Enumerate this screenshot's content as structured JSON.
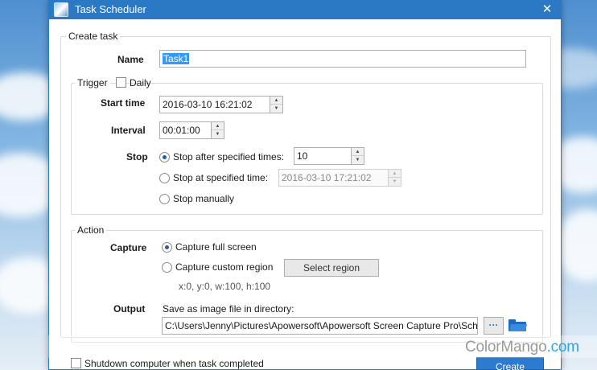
{
  "window": {
    "title": "Task Scheduler",
    "close_glyph": "✕",
    "accent_color": "#2b78c5"
  },
  "create_task": {
    "group_title": "Create task",
    "name_label": "Name",
    "name_value": "Task1"
  },
  "trigger": {
    "group_title": "Trigger",
    "daily_label": "Daily",
    "daily_checked": false,
    "start_time_label": "Start time",
    "start_time_value": "2016-03-10 16:21:02",
    "interval_label": "Interval",
    "interval_value": "00:01:00",
    "stop_label": "Stop",
    "stop_options": [
      {
        "label": "Stop after specified times:",
        "checked": true
      },
      {
        "label": "Stop at specified time:",
        "checked": false
      },
      {
        "label": "Stop manually",
        "checked": false
      }
    ],
    "stop_times_value": "10",
    "stop_at_time_value": "2016-03-10 17:21:02"
  },
  "action": {
    "group_title": "Action",
    "capture_label": "Capture",
    "capture_options": [
      {
        "label": "Capture full screen",
        "checked": true
      },
      {
        "label": "Capture custom region",
        "checked": false
      }
    ],
    "select_region_label": "Select region",
    "region_info": "x:0, y:0, w:100, h:100",
    "output_label": "Output",
    "output_caption": "Save as image file in directory:",
    "output_path": "C:\\Users\\Jenny\\Pictures\\Apowersoft\\Apowersoft Screen Capture Pro\\Sch",
    "browse_label": "···"
  },
  "footer": {
    "shutdown_label": "Shutdown computer when task completed",
    "create_label": "Create"
  },
  "watermark": {
    "brand": "ColorMango",
    "suffix": ".com"
  },
  "icons": {
    "app": "app-icon",
    "folder": "folder-icon"
  }
}
